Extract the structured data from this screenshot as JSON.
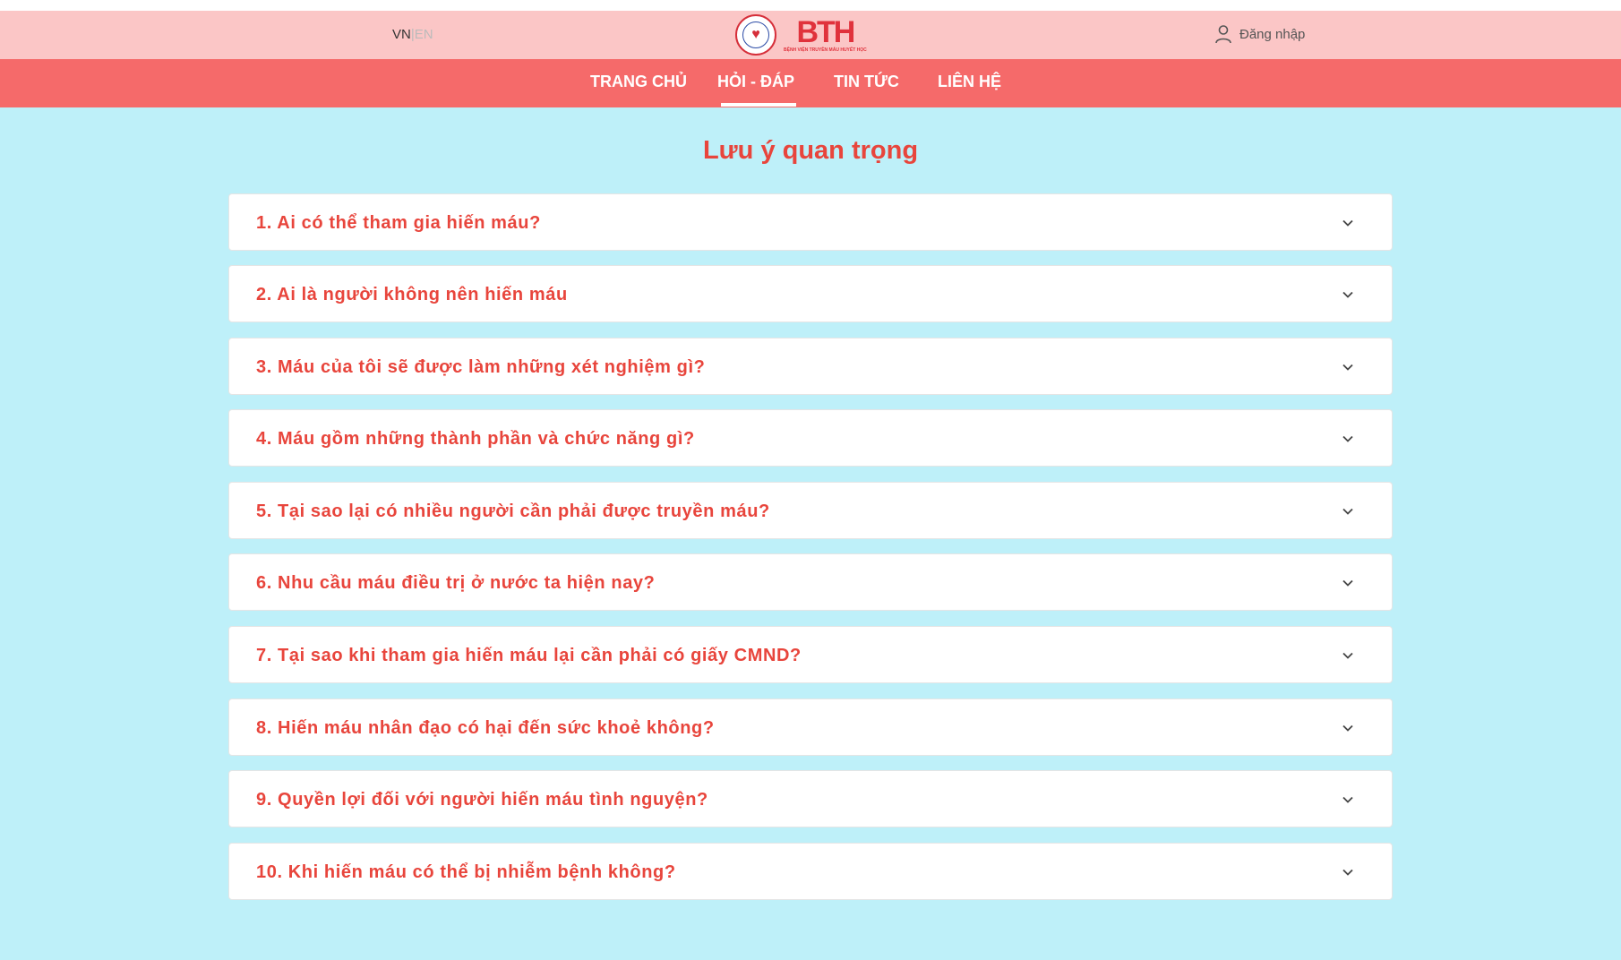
{
  "header": {
    "lang_vn": "VN",
    "lang_sep": "|",
    "lang_en": "EN",
    "logo_text": "BTH",
    "logo_subtext": "BỆNH VIỆN TRUYỀN MÁU HUYẾT HỌC",
    "login_label": "Đăng nhập",
    "login_icon": "user-icon"
  },
  "nav": {
    "items": [
      {
        "label": "TRANG CHỦ"
      },
      {
        "label": "HỎI - ĐÁP"
      },
      {
        "label": "TIN TỨC"
      },
      {
        "label": "LIÊN HỆ"
      }
    ],
    "active": "HỎI - ĐÁP"
  },
  "main": {
    "title": "Lưu ý quan trọng",
    "faq": [
      {
        "question": "1. Ai có thể tham gia hiến máu?"
      },
      {
        "question": "2. Ai là người không nên hiến máu"
      },
      {
        "question": "3. Máu của tôi sẽ được làm những xét nghiệm gì?"
      },
      {
        "question": "4. Máu gồm những thành phần và chức năng gì?"
      },
      {
        "question": "5. Tại sao lại có nhiều người cần phải được truyền máu?"
      },
      {
        "question": "6. Nhu cầu máu điều trị ở nước ta hiện nay?"
      },
      {
        "question": "7. Tại sao khi tham gia hiến máu lại cần phải có giấy CMND?"
      },
      {
        "question": "8. Hiến máu nhân đạo có hại đến sức khoẻ không?"
      },
      {
        "question": "9. Quyền lợi đối với người hiến máu tình nguyện?"
      },
      {
        "question": "10. Khi hiến máu có thể bị nhiễm bệnh không?"
      }
    ]
  },
  "colors": {
    "topbar": "#fbc6c6",
    "navbar": "#f56a6a",
    "background": "#bef0f9",
    "accent": "#e8453c"
  }
}
